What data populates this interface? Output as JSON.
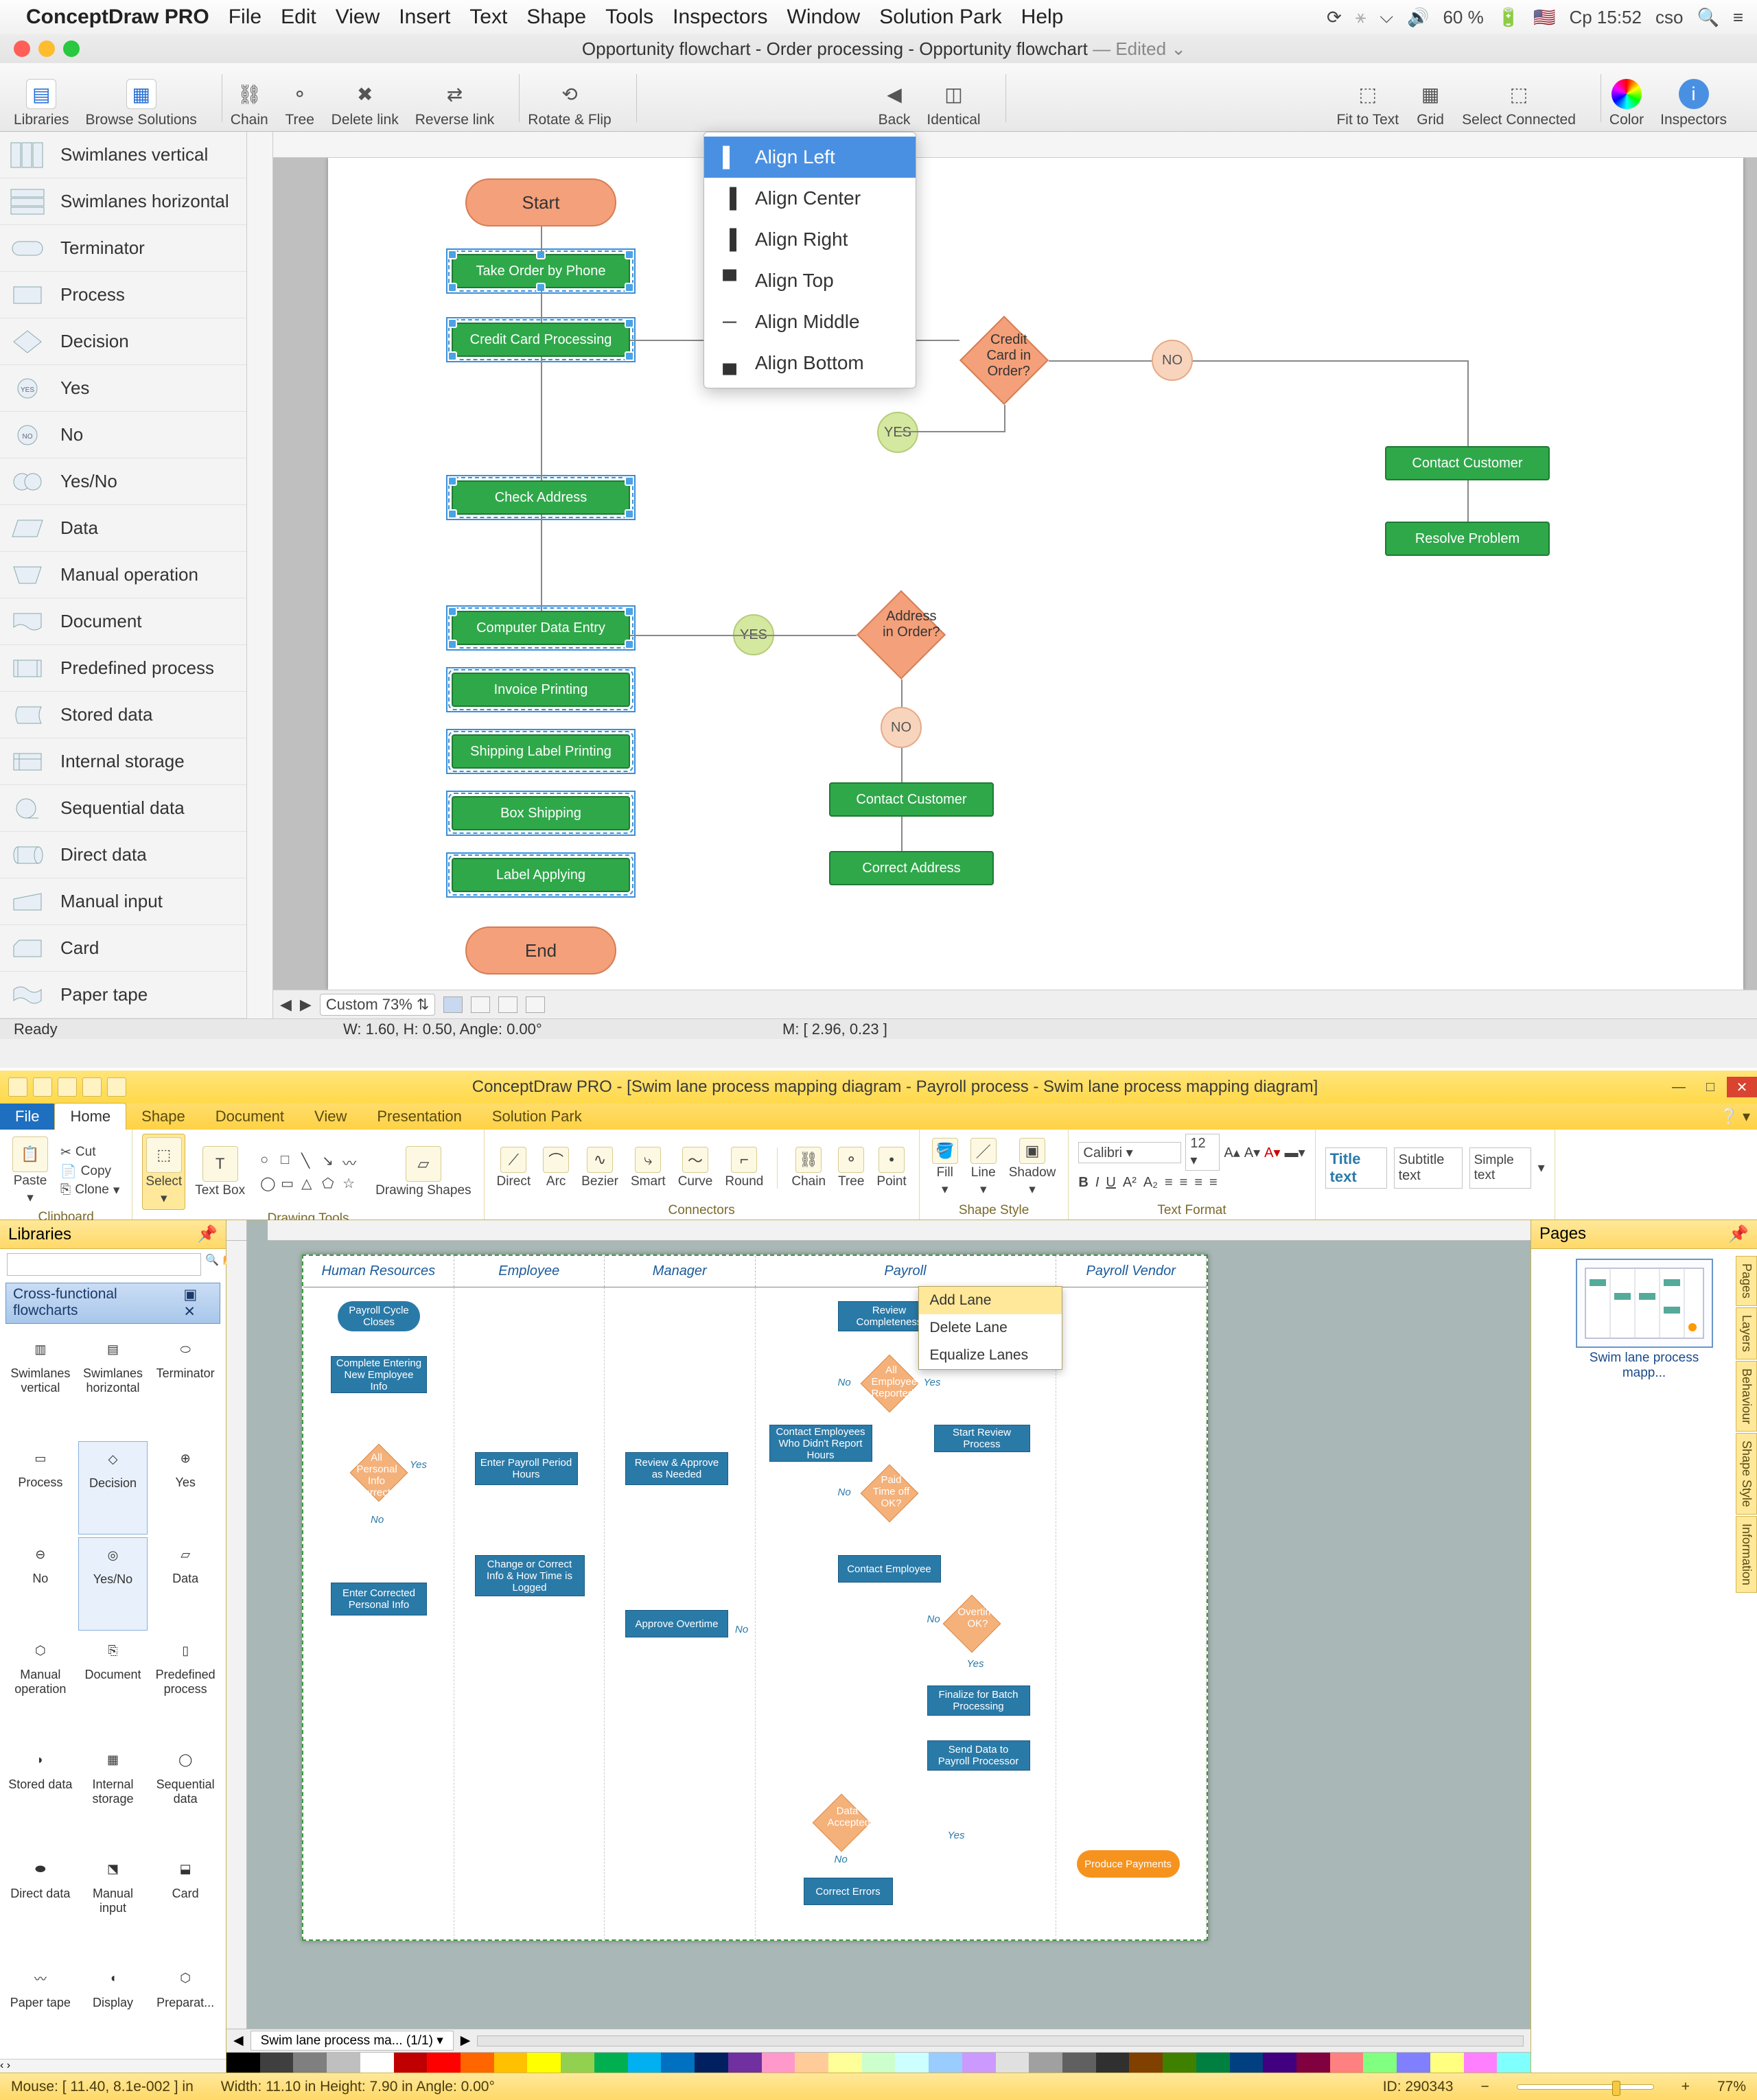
{
  "mac": {
    "menubar": {
      "app": "ConceptDraw PRO",
      "items": [
        "File",
        "Edit",
        "View",
        "Insert",
        "Text",
        "Shape",
        "Tools",
        "Inspectors",
        "Window",
        "Solution Park",
        "Help"
      ],
      "battery": "60 %",
      "clock": "Cp 15:52",
      "user": "cso"
    },
    "title": "Opportunity flowchart - Order processing - Opportunity flowchart",
    "edited": "— Edited",
    "toolbar": {
      "libraries": "Libraries",
      "browse": "Browse Solutions",
      "chain": "Chain",
      "tree": "Tree",
      "delete_link": "Delete link",
      "reverse_link": "Reverse link",
      "rotate_flip": "Rotate & Flip",
      "back": "Back",
      "identical": "Identical",
      "fit": "Fit to Text",
      "grid": "Grid",
      "select_connected": "Select Connected",
      "color": "Color",
      "inspectors": "Inspectors"
    },
    "align_menu": [
      "Align Left",
      "Align Center",
      "Align Right",
      "Align Top",
      "Align Middle",
      "Align Bottom"
    ],
    "shape_panel": [
      "Swimlanes vertical",
      "Swimlanes horizontal",
      "Terminator",
      "Process",
      "Decision",
      "Yes",
      "No",
      "Yes/No",
      "Data",
      "Manual operation",
      "Document",
      "Predefined process",
      "Stored data",
      "Internal storage",
      "Sequential data",
      "Direct data",
      "Manual input",
      "Card",
      "Paper tape"
    ],
    "flow": {
      "start": "Start",
      "take_order": "Take Order by Phone",
      "cc_proc": "Credit Card Processing",
      "check_addr": "Check Address",
      "data_entry": "Computer Data Entry",
      "invoice": "Invoice Printing",
      "ship_label": "Shipping Label Printing",
      "box_ship": "Box Shipping",
      "label_apply": "Label Applying",
      "end": "End",
      "cc_dec": "Credit Card in Order?",
      "addr_dec": "Address in Order?",
      "contact1": "Contact Customer",
      "correct_addr": "Correct Address",
      "contact2": "Contact Customer",
      "resolve": "Resolve Problem",
      "yes": "YES",
      "no": "NO"
    },
    "zoom": "Custom 73%",
    "status_ready": "Ready",
    "status_wh": "W: 1.60,  H: 0.50,  Angle: 0.00°",
    "status_m": "M: [ 2.96, 0.23 ]"
  },
  "win": {
    "title": "ConceptDraw PRO - [Swim lane process mapping diagram - Payroll process - Swim lane process mapping diagram]",
    "tabs": {
      "file": "File",
      "home": "Home",
      "shape": "Shape",
      "document": "Document",
      "view": "View",
      "presentation": "Presentation",
      "solution": "Solution Park"
    },
    "ribbon": {
      "paste": "Paste",
      "cut": "Cut",
      "copy": "Copy",
      "clone": "Clone",
      "clipboard": "Clipboard",
      "select": "Select",
      "textbox": "Text Box",
      "drawing_tools": "Drawing Tools",
      "drawing_shapes": "Drawing Shapes",
      "direct": "Direct",
      "arc": "Arc",
      "bezier": "Bezier",
      "smart": "Smart",
      "curve": "Curve",
      "round": "Round",
      "connectors": "Connectors",
      "chain": "Chain",
      "tree": "Tree",
      "point": "Point",
      "fill": "Fill",
      "line": "Line",
      "shadow": "Shadow",
      "shape_style": "Shape Style",
      "font": "Calibri",
      "size": "12",
      "text_format": "Text Format",
      "title_t": "Title text",
      "subtitle_t": "Subtitle text",
      "simple_t": "Simple text"
    },
    "libraries_hdr": "Libraries",
    "lib_cat": "Cross-functional flowcharts",
    "lib_items": [
      "Swimlanes vertical",
      "Swimlanes horizontal",
      "Terminator",
      "Process",
      "Decision",
      "Yes",
      "No",
      "Yes/No",
      "Data",
      "Manual operation",
      "Document",
      "Predefined process",
      "Stored data",
      "Internal storage",
      "Sequential data",
      "Direct data",
      "Manual input",
      "Card",
      "Paper tape",
      "Display",
      "Preparat..."
    ],
    "ctx": {
      "add": "Add Lane",
      "del": "Delete Lane",
      "eq": "Equalize Lanes"
    },
    "lanes": [
      "Human Resources",
      "Employee",
      "Manager",
      "Payroll",
      "Payroll Vendor"
    ],
    "nodes": {
      "payroll_cycle": "Payroll Cycle Closes",
      "complete_enter": "Complete Entering New Employee Info",
      "all_info": "All Personal Info Correct?",
      "enter_corr": "Enter Corrected Personal Info",
      "enter_period": "Enter Payroll Period Hours",
      "change_corr": "Change or Correct Info & How Time is Logged",
      "review_approve": "Review & Approve as Needed",
      "approve_ot": "Approve Overtime",
      "review_comp": "Review Completeness",
      "all_emp": "All Employees Reported?",
      "contact_emp": "Contact Employees Who Didn't Report Hours",
      "paid_time": "Paid Time off OK?",
      "contact_emp2": "Contact Employee",
      "overtime_ok": "Overtime OK?",
      "finalize": "Finalize for Batch Processing",
      "send_data": "Send Data to Payroll Processor",
      "data_acc": "Data Accepted?",
      "correct_err": "Correct Errors",
      "start_review": "Start Review Process",
      "produce": "Produce Payments",
      "yes": "Yes",
      "no": "No"
    },
    "pages_hdr": "Pages",
    "page_thumb": "Swim lane process mapp...",
    "side_tabs": [
      "Pages",
      "Layers",
      "Behaviour",
      "Shape Style",
      "Information"
    ],
    "doc_tab": "Swim lane process ma... (1/1)",
    "status": {
      "mouse": "Mouse: [ 11.40, 8.1e-002 ] in",
      "dims": "Width: 11.10 in   Height: 7.90 in   Angle: 0.00°",
      "id": "ID: 290343",
      "zoom": "77%"
    },
    "colors": [
      "#000000",
      "#3f3f3f",
      "#7f7f7f",
      "#bfbfbf",
      "#ffffff",
      "#c00000",
      "#ff0000",
      "#ff6600",
      "#ffc000",
      "#ffff00",
      "#92d050",
      "#00b050",
      "#00b0f0",
      "#0070c0",
      "#002060",
      "#7030a0",
      "#ff99cc",
      "#ffcc99",
      "#ffff99",
      "#ccffcc",
      "#ccffff",
      "#99ccff",
      "#cc99ff",
      "#e0e0e0",
      "#a0a0a0",
      "#606060",
      "#303030",
      "#804000",
      "#408000",
      "#008040",
      "#004080",
      "#400080",
      "#800040",
      "#ff8080",
      "#80ff80",
      "#8080ff",
      "#ffff80",
      "#ff80ff",
      "#80ffff"
    ]
  }
}
